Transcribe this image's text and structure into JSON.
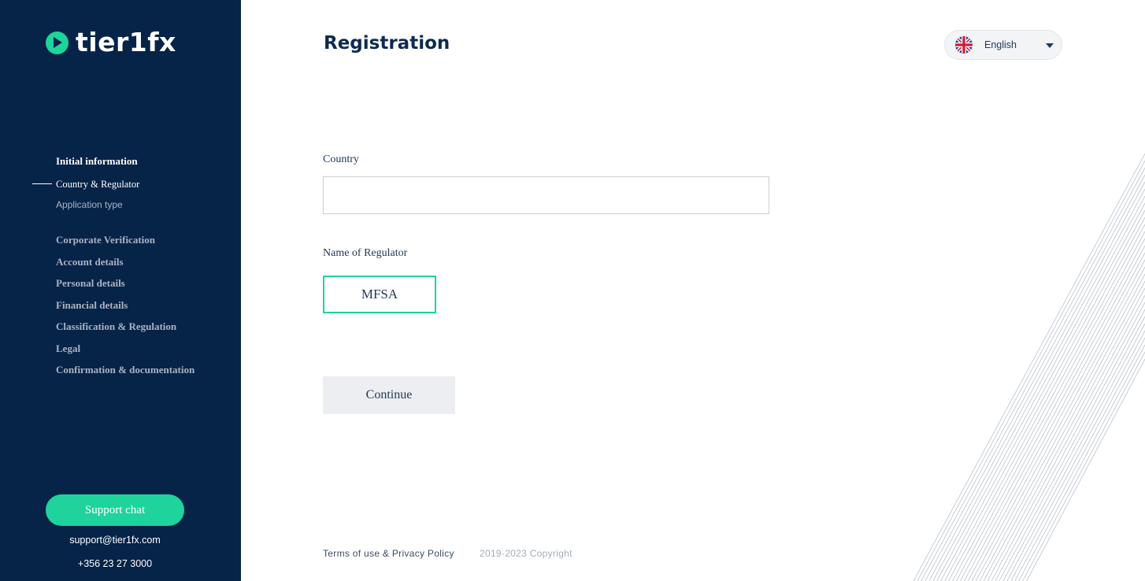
{
  "brand": {
    "name": "tier1fx",
    "accent_color": "#1ed49c",
    "sidebar_color": "#062348"
  },
  "sidebar": {
    "group_title": "Initial information",
    "substeps": [
      {
        "label": "Country & Regulator",
        "state": "active"
      },
      {
        "label": "Application type",
        "state": "inactive"
      }
    ],
    "steps": [
      "Corporate Verification",
      "Account details",
      "Personal details",
      "Financial details",
      "Classification & Regulation",
      "Legal",
      "Confirmation & documentation"
    ],
    "support_button": "Support chat",
    "support_email": "support@tier1fx.com",
    "support_phone": "+356 23 27 3000"
  },
  "header": {
    "title": "Registration",
    "language": {
      "label": "English",
      "flag_icon": "uk-flag-icon"
    }
  },
  "form": {
    "country_label": "Country",
    "country_value": "",
    "regulator_label": "Name of Regulator",
    "regulator_option": "MFSA",
    "continue_label": "Continue"
  },
  "footer": {
    "links": "Terms of use & Privacy Policy",
    "copyright": "2019-2023 Copyright"
  }
}
